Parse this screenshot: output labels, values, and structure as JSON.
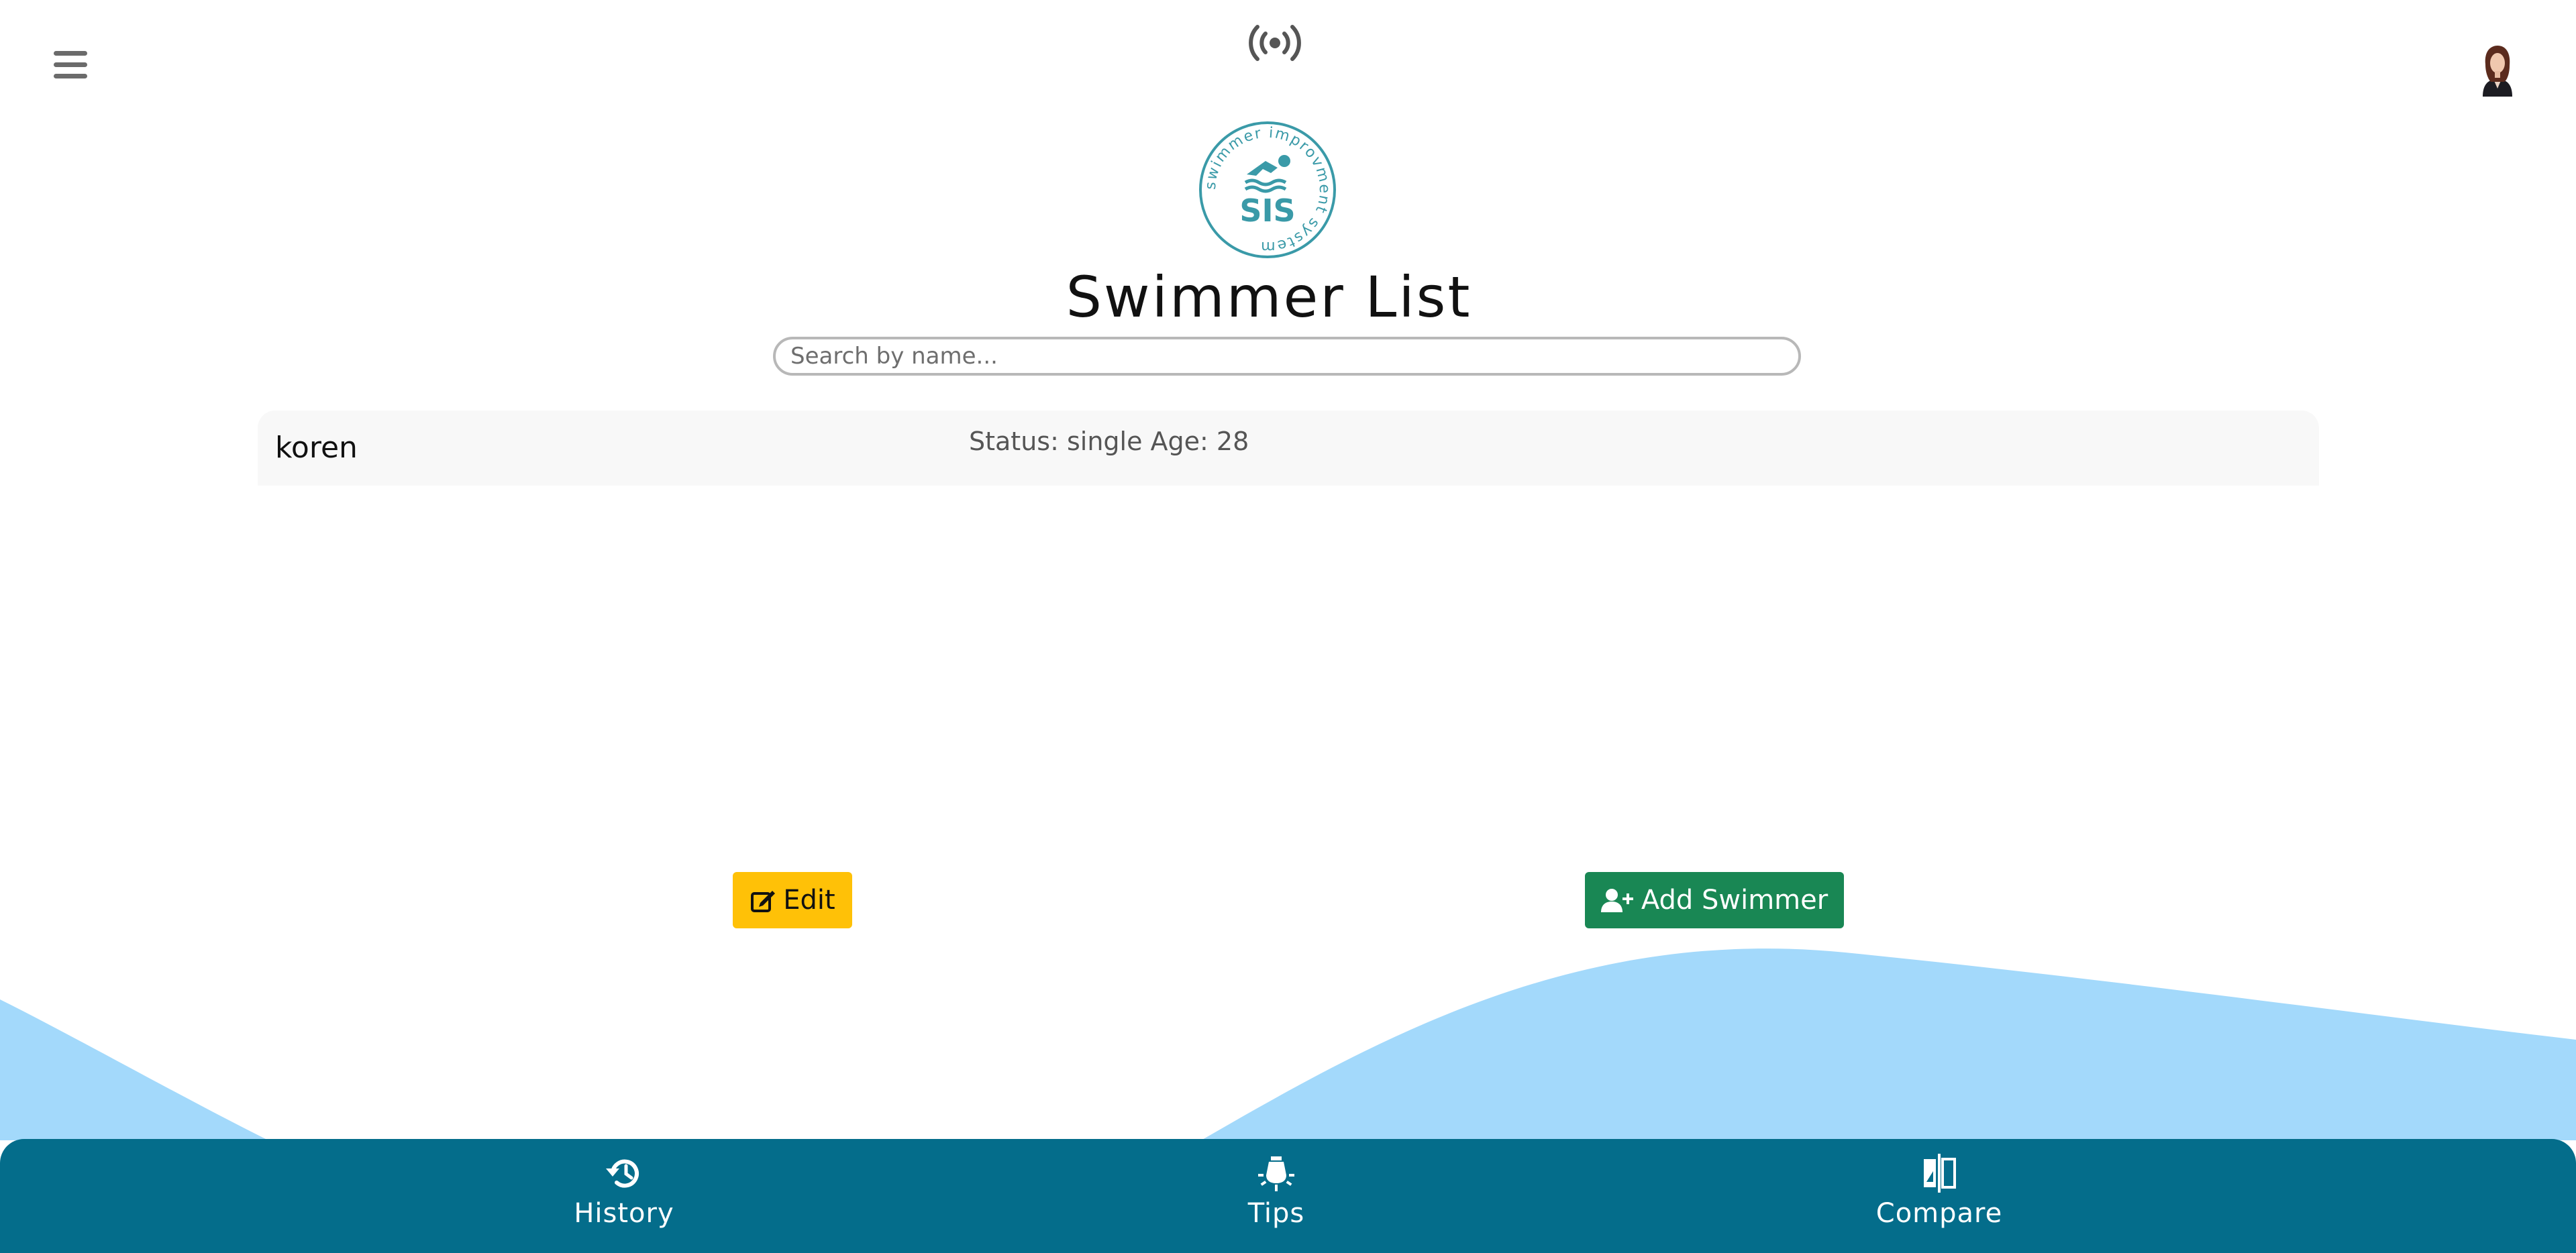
{
  "header": {
    "menu_icon": "hamburger-menu-icon",
    "status_icon": "broadcast-icon",
    "avatar": "user-avatar"
  },
  "logo": {
    "ring_text": "swimmer improvment system",
    "initials": "SIS"
  },
  "page": {
    "title": "Swimmer List"
  },
  "search": {
    "placeholder": "Search by name..."
  },
  "swimmers": [
    {
      "name": "koren",
      "details": "Status: single Age: 28"
    }
  ],
  "actions": {
    "edit_label": "Edit",
    "add_label": "Add Swimmer"
  },
  "bottom_nav": {
    "items": [
      {
        "label": "History",
        "icon": "history-icon"
      },
      {
        "label": "Tips",
        "icon": "lightbulb-icon"
      },
      {
        "label": "Compare",
        "icon": "compare-icon"
      }
    ]
  },
  "colors": {
    "nav_background": "#046d8b",
    "wave": "#a3d9fb",
    "edit_button": "#ffc107",
    "add_button": "#198754",
    "logo": "#3a9aa8"
  }
}
